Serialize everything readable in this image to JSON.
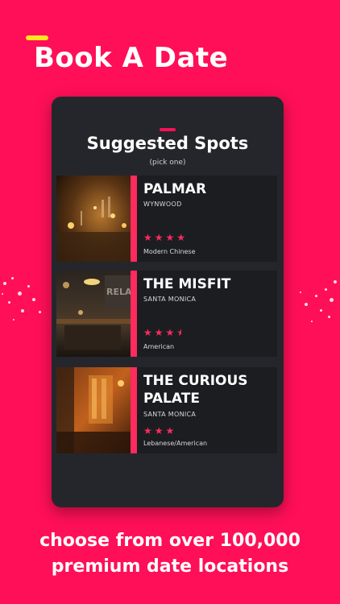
{
  "header": {
    "title": "Book A Date",
    "accent_color": "#FFE51F"
  },
  "background_color": "#FF0F57",
  "screen": {
    "title": "Suggested Spots",
    "subtitle": "(pick one)",
    "spots": [
      {
        "name": "PALMAR",
        "location": "WYNWOOD",
        "rating": 4,
        "cuisine": "Modern Chinese",
        "photo": "restaurant-candlelit-tables-photo"
      },
      {
        "name": "THE MISFIT",
        "location": "SANTA MONICA",
        "rating": 3.5,
        "cuisine": "American",
        "photo": "restaurant-relax-sign-bar-photo"
      },
      {
        "name": "THE CURIOUS PALATE",
        "location": "SANTA MONICA",
        "rating": 3,
        "cuisine": "Lebanese/American",
        "photo": "restaurant-warm-interior-photo"
      }
    ]
  },
  "footer": {
    "line1": "choose from over 100,000",
    "line2": "premium date locations"
  }
}
